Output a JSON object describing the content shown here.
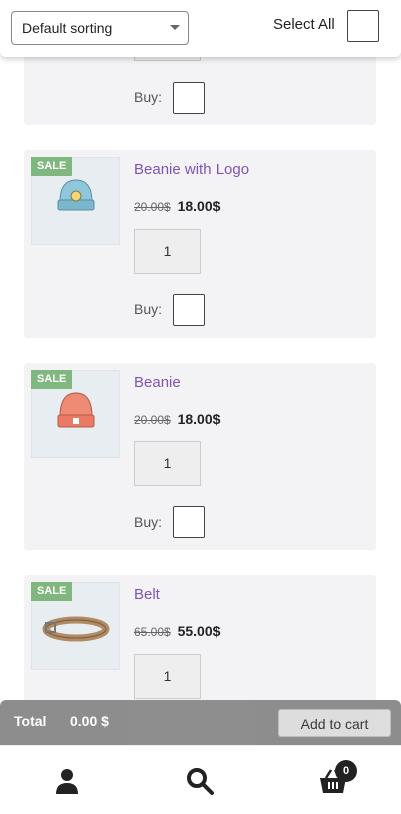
{
  "toolbar": {
    "sort_value": "Default sorting",
    "select_all_label": "Select All"
  },
  "products": [
    {
      "buy_label": "Buy:"
    },
    {
      "sale_badge": "SALE",
      "name": "Beanie with Logo",
      "old_price": "20.00$",
      "new_price": "18.00$",
      "qty": "1",
      "buy_label": "Buy:",
      "image": "beanie-with-logo-icon"
    },
    {
      "sale_badge": "SALE",
      "name": "Beanie",
      "old_price": "20.00$",
      "new_price": "18.00$",
      "qty": "1",
      "buy_label": "Buy:",
      "image": "beanie-icon"
    },
    {
      "sale_badge": "SALE",
      "name": "Belt",
      "old_price": "65.00$",
      "new_price": "55.00$",
      "qty": "1",
      "image": "belt-icon"
    }
  ],
  "cart": {
    "total_label": "Total",
    "total_value": "0.00 $",
    "add_to_cart_label": "Add to cart",
    "count": "0"
  },
  "footer": {
    "icons": [
      "user-icon",
      "search-icon",
      "basket-icon"
    ]
  }
}
